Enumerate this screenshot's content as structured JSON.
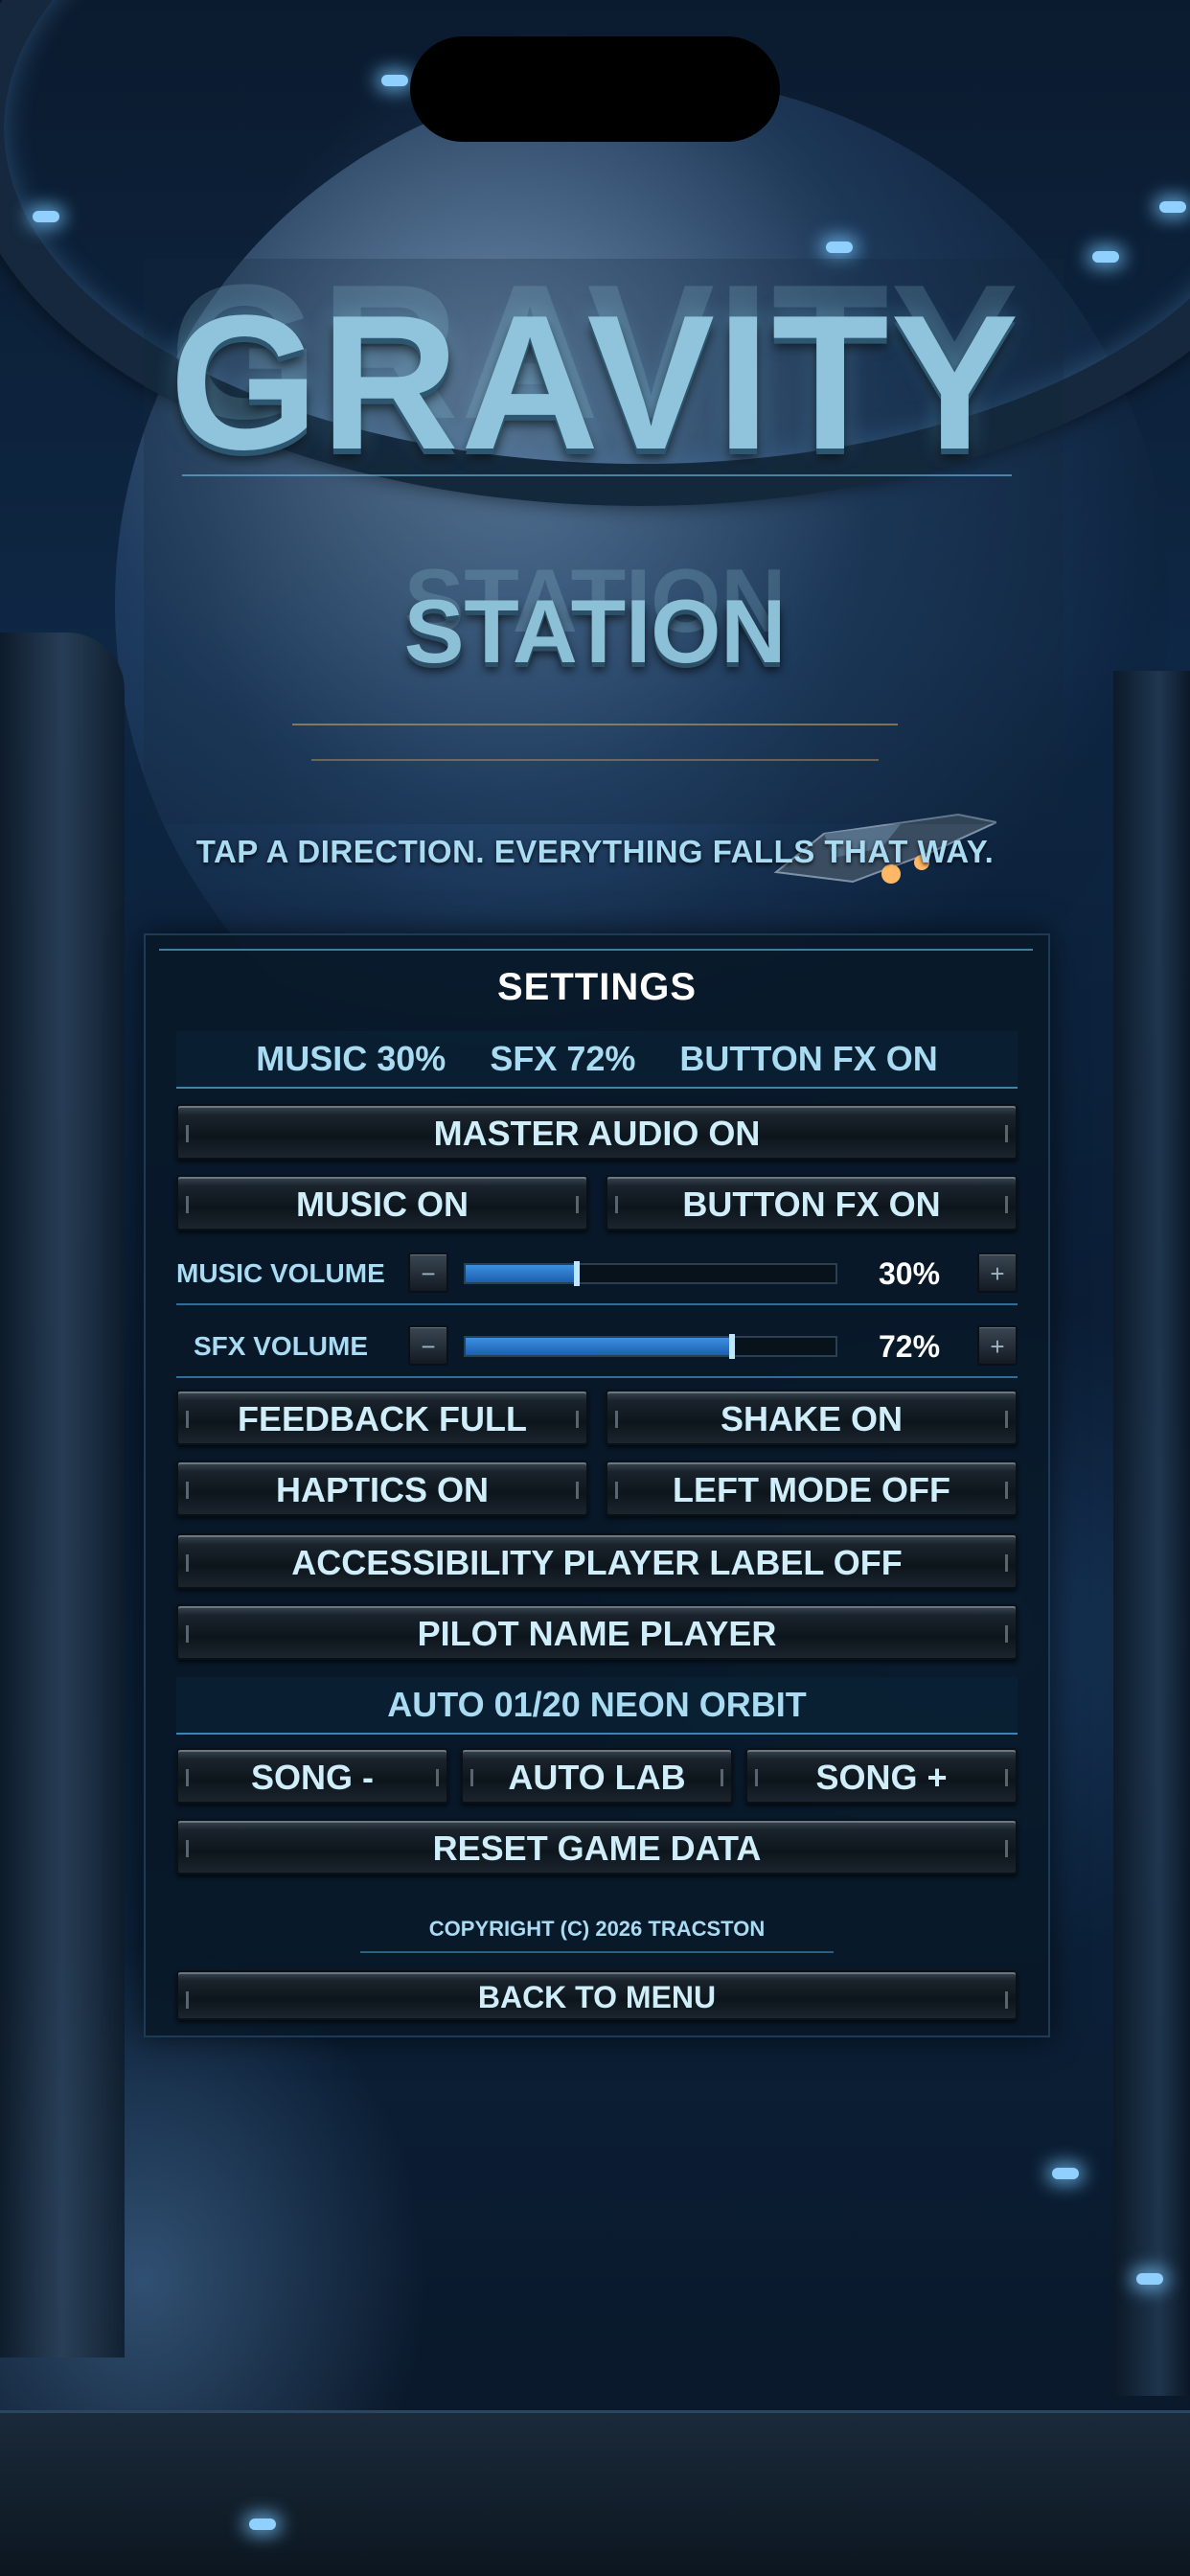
{
  "title": {
    "main": "GRAVITY",
    "sub": "STATION",
    "tagline": "TAP A DIRECTION. EVERYTHING FALLS THAT WAY."
  },
  "settings": {
    "heading": "SETTINGS",
    "summary": {
      "music": "MUSIC 30%",
      "sfx": "SFX 72%",
      "button_fx": "BUTTON FX ON"
    },
    "master_audio": "MASTER AUDIO ON",
    "music_toggle": "MUSIC ON",
    "button_fx_toggle": "BUTTON FX ON",
    "music_volume": {
      "label": "MUSIC VOLUME",
      "value_text": "30%",
      "level": 30,
      "decrease_icon": "minus-icon",
      "increase_icon": "plus-icon"
    },
    "sfx_volume": {
      "label": "SFX VOLUME",
      "value_text": "72%",
      "level": 72,
      "decrease_icon": "minus-icon",
      "increase_icon": "plus-icon"
    },
    "feedback": "FEEDBACK FULL",
    "shake": "SHAKE ON",
    "haptics": "HAPTICS ON",
    "left_mode": "LEFT MODE OFF",
    "accessibility": "ACCESSIBILITY PLAYER LABEL OFF",
    "pilot_name": "PILOT NAME  PLAYER",
    "track_info": "AUTO 01/20  NEON ORBIT",
    "song_prev": "SONG -",
    "auto_lab": "AUTO LAB",
    "song_next": "SONG +",
    "reset": "RESET GAME DATA",
    "copyright": "COPYRIGHT (C) 2026 TRACSTON",
    "back": "BACK TO MENU"
  },
  "colors": {
    "accent": "#a9dcf2",
    "slider_fill": "#3d8fe0",
    "panel_bg": "#081828"
  }
}
